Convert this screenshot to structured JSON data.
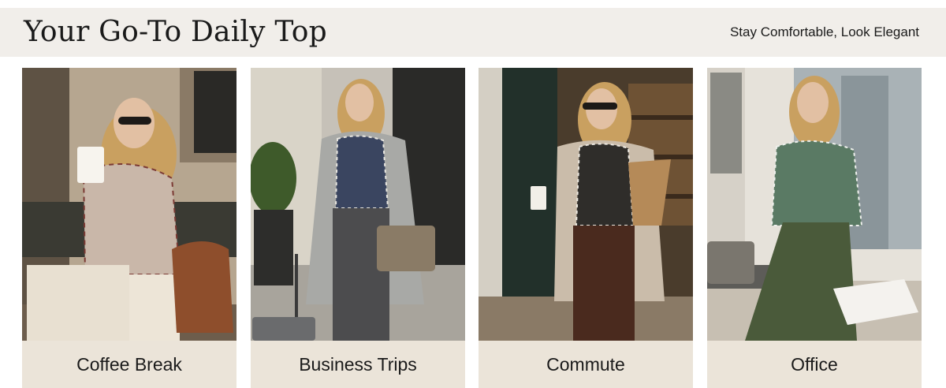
{
  "banner": {
    "title": "Your Go-To Daily Top",
    "tagline": "Stay Comfortable, Look Elegant"
  },
  "cards": [
    {
      "caption": "Coffee Break"
    },
    {
      "caption": "Business Trips"
    },
    {
      "caption": "Commute"
    },
    {
      "caption": "Office"
    }
  ],
  "colors": {
    "header_bg": "#f1eeea",
    "caption_bg": "#ebe4d9",
    "text": "#1a1a1a"
  }
}
